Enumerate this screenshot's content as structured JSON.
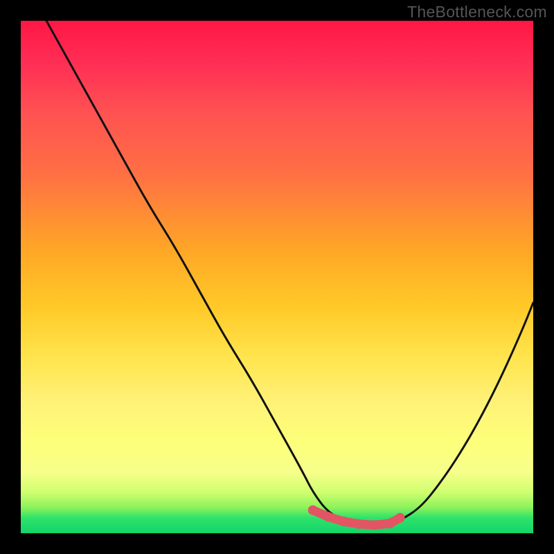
{
  "watermark": "TheBottleneck.com",
  "colors": {
    "curve_stroke": "#111111",
    "marker_stroke": "#e25563",
    "marker_fill": "#e25563"
  },
  "chart_data": {
    "type": "line",
    "title": "",
    "xlabel": "",
    "ylabel": "",
    "xlim": [
      0,
      100
    ],
    "ylim": [
      0,
      100
    ],
    "note": "No axes or tick labels are visible; values are estimated from pixel positions on a 0–100 normalized scale.",
    "series": [
      {
        "name": "bottleneck-curve",
        "x": [
          5,
          10,
          15,
          20,
          25,
          30,
          35,
          40,
          45,
          50,
          55,
          57,
          60,
          64,
          68,
          72,
          74,
          78,
          82,
          86,
          90,
          94,
          98,
          100
        ],
        "y": [
          100,
          91,
          82,
          73,
          64,
          56,
          47,
          38,
          30,
          21,
          12,
          8,
          4,
          2,
          1.3,
          1.5,
          2.5,
          5,
          10,
          16,
          23,
          31,
          40,
          45
        ]
      }
    ],
    "markers": {
      "name": "optimal-range-markers",
      "points_x": [
        57,
        60,
        63,
        66,
        69,
        72,
        74
      ],
      "points_y": [
        4.5,
        3.2,
        2.3,
        1.8,
        1.6,
        1.9,
        3.0
      ]
    }
  }
}
